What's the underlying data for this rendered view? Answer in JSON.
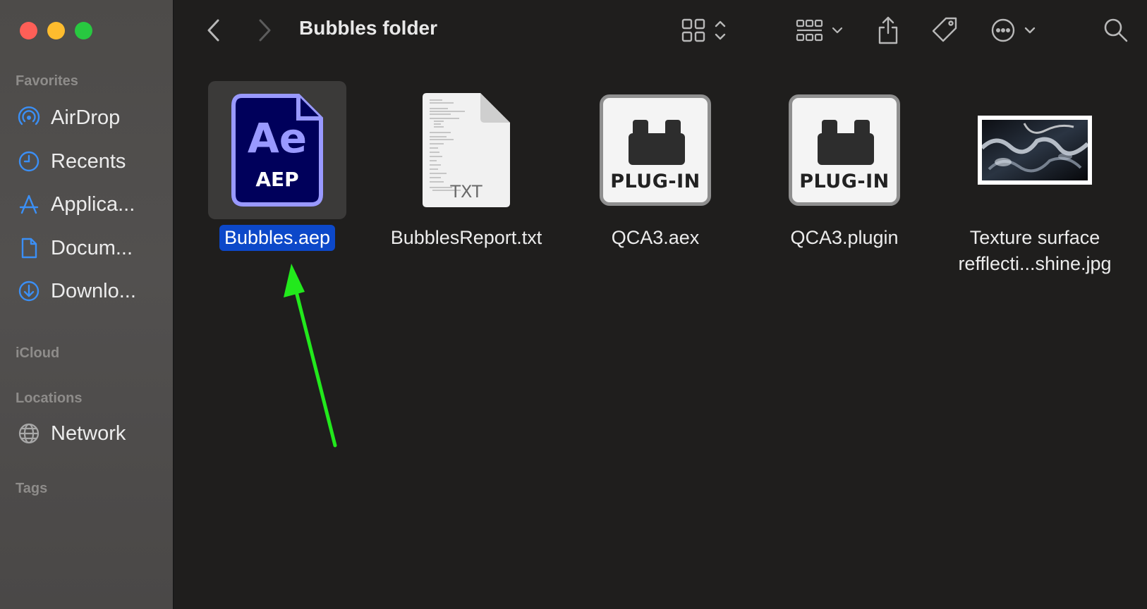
{
  "window": {
    "title": "Bubbles folder"
  },
  "sidebar": {
    "sections": {
      "favorites": "Favorites",
      "icloud": "iCloud",
      "locations": "Locations",
      "tags": "Tags"
    },
    "favorites": [
      {
        "label": "AirDrop",
        "icon": "airdrop-icon"
      },
      {
        "label": "Recents",
        "icon": "clock-icon"
      },
      {
        "label": "Applica...",
        "icon": "applications-icon"
      },
      {
        "label": "Docum...",
        "icon": "document-icon"
      },
      {
        "label": "Downlo...",
        "icon": "download-icon"
      }
    ],
    "locations": [
      {
        "label": "Network",
        "icon": "globe-icon"
      }
    ]
  },
  "files": [
    {
      "name": "Bubbles.aep",
      "kind": "aep",
      "icon_text_top": "Ae",
      "icon_text_bottom": "AEP",
      "selected": true
    },
    {
      "name": "BubblesReport.txt",
      "kind": "txt",
      "icon_text": "TXT",
      "selected": false
    },
    {
      "name": "QCA3.aex",
      "kind": "plugin",
      "icon_text": "PLUG-IN",
      "selected": false
    },
    {
      "name": "QCA3.plugin",
      "kind": "plugin",
      "icon_text": "PLUG-IN",
      "selected": false
    },
    {
      "name_line1": "Texture surface",
      "name_line2": "refflecti...shine.jpg",
      "kind": "image",
      "selected": false
    }
  ],
  "colors": {
    "selection": "#0c48c9",
    "accent_icon": "#3b8ff5",
    "annotation_arrow": "#22e91c",
    "aep_purple": "#9999ff",
    "aep_bg": "#00005b"
  }
}
